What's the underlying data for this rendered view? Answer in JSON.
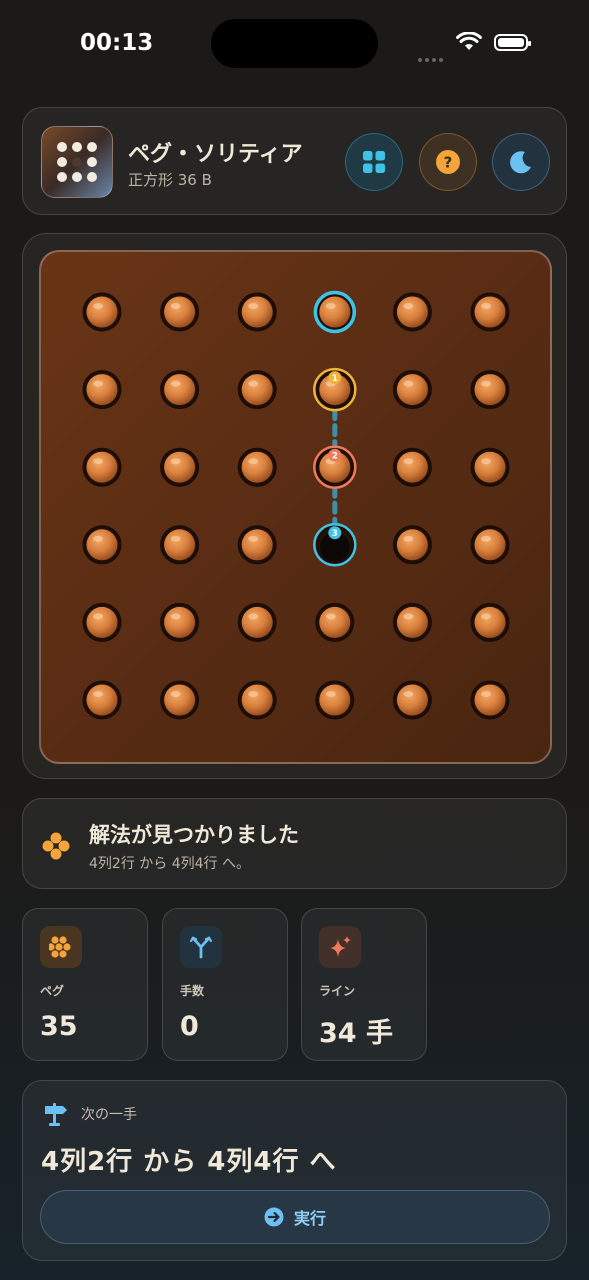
{
  "status_bar": {
    "time": "00:13"
  },
  "header": {
    "title": "ペグ・ソリティア",
    "subtitle": "正方形 36 B",
    "buttons": [
      {
        "name": "grid-layout-button",
        "icon": "grid-icon",
        "color": "#3ec3e6"
      },
      {
        "name": "help-button",
        "icon": "question-icon",
        "color": "#f5a43a"
      },
      {
        "name": "theme-toggle-button",
        "icon": "moon-icon",
        "color": "#6cc0f2"
      }
    ]
  },
  "board": {
    "rows": 6,
    "cols": 6,
    "empty": [
      [
        3,
        3
      ]
    ],
    "selected": [
      0,
      3
    ],
    "path": [
      {
        "row": 1,
        "col": 3,
        "label": "1",
        "color": "#f0b43a"
      },
      {
        "row": 2,
        "col": 3,
        "label": "2",
        "color": "#ef7a5e"
      },
      {
        "row": 3,
        "col": 3,
        "label": "3",
        "color": "#3ec3e6"
      }
    ]
  },
  "solution": {
    "title": "解法が見つかりました",
    "detail": "4列2行 から 4列4行 へ。"
  },
  "stats": [
    {
      "label": "ペグ",
      "value": "35",
      "icon": "peg-cluster-icon",
      "color": "#f5a43a"
    },
    {
      "label": "手数",
      "value": "0",
      "icon": "branch-icon",
      "color": "#6cc0f2"
    },
    {
      "label": "ライン",
      "value": "34 手",
      "icon": "sparkle-icon",
      "color": "#ef7a5e"
    }
  ],
  "next_move": {
    "label": "次の一手",
    "move": "4列2行 から 4列4行 へ",
    "button_label": "実行"
  },
  "colors": {
    "accent_cyan": "#3ec3e6",
    "accent_orange": "#f5a43a",
    "accent_red": "#ef7a5e"
  }
}
